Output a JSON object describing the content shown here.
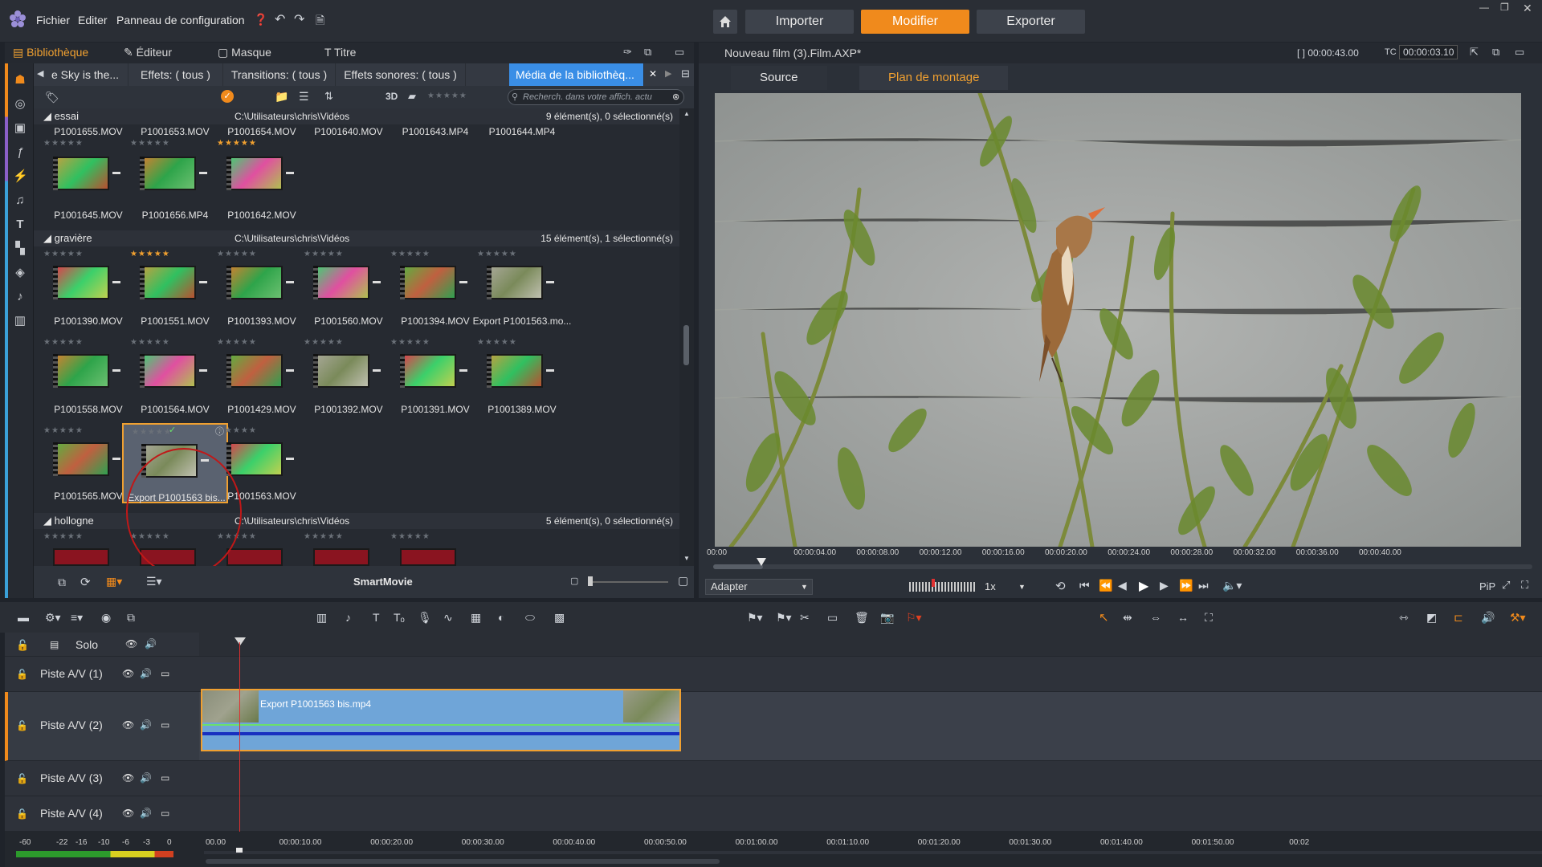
{
  "menu": {
    "file": "Fichier",
    "edit": "Editer",
    "control_panel": "Panneau de configuration"
  },
  "modes": {
    "import": "Importer",
    "edit": "Modifier",
    "export": "Exporter"
  },
  "library": {
    "tabs": {
      "library": "Bibliothèque",
      "editor": "Éditeur",
      "mask": "Masque",
      "title": "Titre"
    },
    "filter_tabs": [
      "e Sky is the...",
      "Effets: ( tous )",
      "Transitions: ( tous )",
      "Effets sonores: ( tous )",
      "Média de la bibliothèq..."
    ],
    "toolbar": {
      "three_d": "3D"
    },
    "search_placeholder": "Recherch. dans votre affich. actu",
    "groups": [
      {
        "name": "essai",
        "path": "C:\\Utilisateurs\\chris\\Vidéos",
        "count": "9 élément(s), 0 sélectionné(s)"
      },
      {
        "name": "gravière",
        "path": "C:\\Utilisateurs\\chris\\Vidéos",
        "count": "15 élément(s), 1 sélectionné(s)"
      },
      {
        "name": "hollogne",
        "path": "C:\\Utilisateurs\\chris\\Vidéos",
        "count": "5 élément(s), 0 sélectionné(s)"
      }
    ],
    "essai_row1": [
      "P1001655.MOV",
      "P1001653.MOV",
      "P1001654.MOV",
      "P1001640.MOV",
      "P1001643.MP4",
      "P1001644.MP4"
    ],
    "essai_row2": [
      "P1001645.MOV",
      "P1001656.MP4",
      "P1001642.MOV"
    ],
    "graviere_row1": [
      "P1001390.MOV",
      "P1001551.MOV",
      "P1001393.MOV",
      "P1001560.MOV",
      "P1001394.MOV",
      "Export P1001563.mo..."
    ],
    "graviere_row2": [
      "P1001558.MOV",
      "P1001564.MOV",
      "P1001429.MOV",
      "P1001392.MOV",
      "P1001391.MOV",
      "P1001389.MOV"
    ],
    "graviere_row3": [
      "P1001565.MOV",
      "Export P1001563 bis...",
      "P1001563.MOV"
    ],
    "smartmovie": "SmartMovie"
  },
  "preview": {
    "title": "Nouveau film (3).Film.AXP*",
    "duration": "00:00:43.00",
    "tc_label": "TC",
    "timecode": "00:00:03.10",
    "tabs": {
      "source": "Source",
      "timeline": "Plan de montage"
    },
    "ruler": [
      "00:00",
      "00:00:04.00",
      "00:00:08.00",
      "00:00:12.00",
      "00:00:16.00",
      "00:00:20.00",
      "00:00:24.00",
      "00:00:28.00",
      "00:00:32.00",
      "00:00:36.00",
      "00:00:40.00"
    ],
    "fit_option": "Adapter",
    "speed": "1x",
    "pip": "PiP"
  },
  "timeline": {
    "solo": "Solo",
    "tracks": [
      "Piste A/V (1)",
      "Piste A/V (2)",
      "Piste A/V (3)",
      "Piste A/V (4)"
    ],
    "clip_name": "Export P1001563 bis.mp4",
    "ruler": [
      "00.00",
      "00:00:10.00",
      "00:00:20.00",
      "00:00:30.00",
      "00:00:40.00",
      "00:00:50.00",
      "00:01:00.00",
      "00:01:10.00",
      "00:01:20.00",
      "00:01:30.00",
      "00:01:40.00",
      "00:01:50.00",
      "00:02"
    ],
    "meter_labels": [
      "-60",
      "-22",
      "-16",
      "-10",
      "-6",
      "-3",
      "0"
    ]
  },
  "colors": {
    "accent": "#f08a1c",
    "active_tab": "#3a8ee6",
    "clip": "#6fa5d8",
    "playhead": "#e03030"
  }
}
